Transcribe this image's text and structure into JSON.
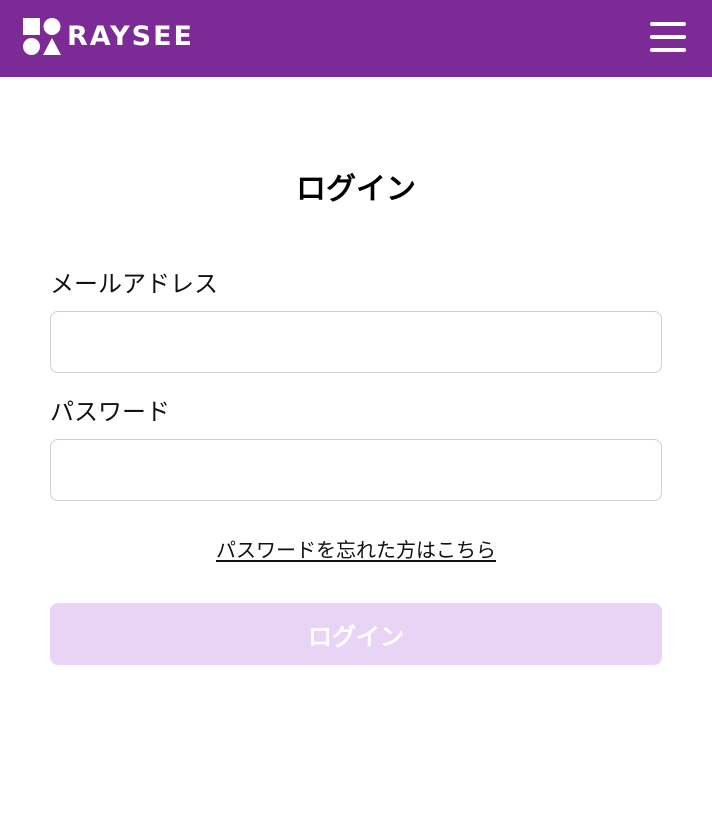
{
  "header": {
    "brand": "RAYSEE",
    "background_color": "#7b2a96",
    "logo_icon": "raysee-shapes-logo-icon",
    "menu_icon": "hamburger-menu-icon"
  },
  "login": {
    "title": "ログイン",
    "email_label": "メールアドレス",
    "email_value": "",
    "password_label": "パスワード",
    "password_value": "",
    "forgot_link": "パスワードを忘れた方はこちら",
    "submit_label": "ログイン",
    "submit_color": "#e9d4f6"
  }
}
